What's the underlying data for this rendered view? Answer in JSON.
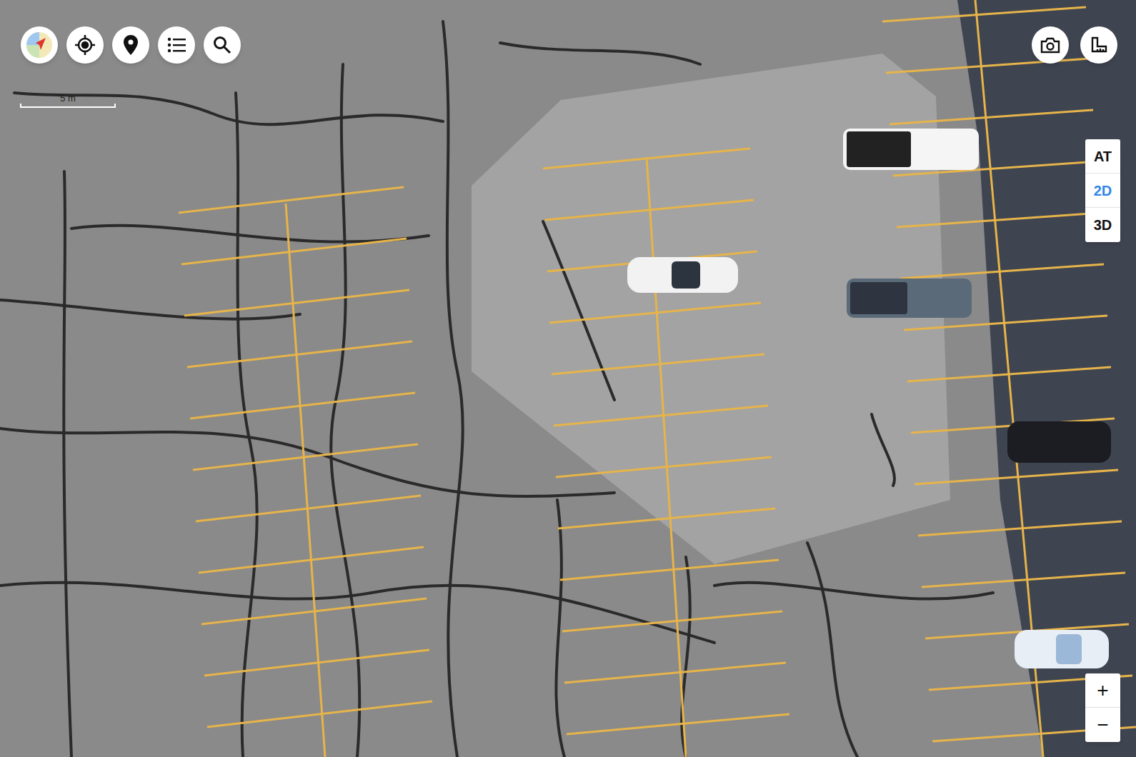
{
  "scale_bar": {
    "label": "5 m"
  },
  "view_modes": [
    {
      "label": "AT",
      "selected": false
    },
    {
      "label": "2D",
      "selected": true
    },
    {
      "label": "3D",
      "selected": false
    }
  ],
  "zoom": {
    "in": "+",
    "out": "−"
  }
}
